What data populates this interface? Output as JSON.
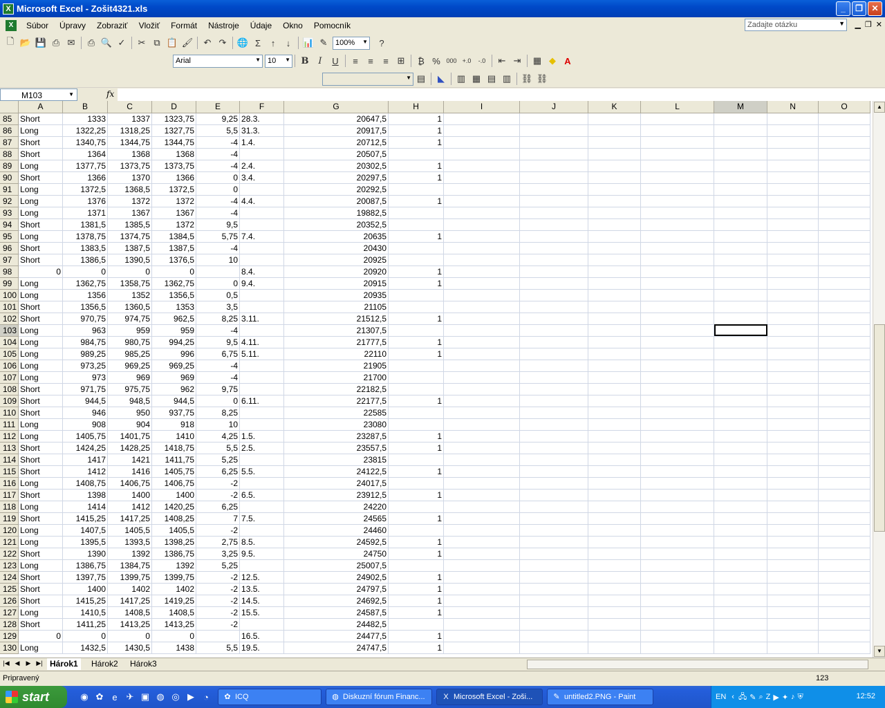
{
  "window": {
    "title": "Microsoft Excel - Zošit4321.xls"
  },
  "menu": [
    "Súbor",
    "Úpravy",
    "Zobraziť",
    "Vložiť",
    "Formát",
    "Nástroje",
    "Údaje",
    "Okno",
    "Pomocník"
  ],
  "help_box": {
    "placeholder": "Zadajte otázku"
  },
  "toolbar": {
    "zoom": "100%",
    "font": "Arial",
    "font_size": "10"
  },
  "formula_bar": {
    "name_box": "M103",
    "fx": "fx",
    "formula": ""
  },
  "columns": [
    "A",
    "B",
    "C",
    "D",
    "E",
    "F",
    "G",
    "H",
    "I",
    "J",
    "K",
    "L",
    "M",
    "N",
    "O"
  ],
  "selected_cell": {
    "row": "103",
    "col": "M"
  },
  "rows": [
    {
      "n": "85",
      "a": "Short",
      "b": "1333",
      "c": "1337",
      "d": "1323,75",
      "e": "9,25",
      "f": "28.3.",
      "g": "20647,5",
      "h": "1"
    },
    {
      "n": "86",
      "a": "Long",
      "b": "1322,25",
      "c": "1318,25",
      "d": "1327,75",
      "e": "5,5",
      "f": "31.3.",
      "g": "20917,5",
      "h": "1"
    },
    {
      "n": "87",
      "a": "Short",
      "b": "1340,75",
      "c": "1344,75",
      "d": "1344,75",
      "e": "-4",
      "f": "1.4.",
      "g": "20712,5",
      "h": "1"
    },
    {
      "n": "88",
      "a": "Short",
      "b": "1364",
      "c": "1368",
      "d": "1368",
      "e": "-4",
      "f": "",
      "g": "20507,5",
      "h": ""
    },
    {
      "n": "89",
      "a": "Long",
      "b": "1377,75",
      "c": "1373,75",
      "d": "1373,75",
      "e": "-4",
      "f": "2.4.",
      "g": "20302,5",
      "h": "1"
    },
    {
      "n": "90",
      "a": "Short",
      "b": "1366",
      "c": "1370",
      "d": "1366",
      "e": "0",
      "f": "3.4.",
      "g": "20297,5",
      "h": "1"
    },
    {
      "n": "91",
      "a": "Long",
      "b": "1372,5",
      "c": "1368,5",
      "d": "1372,5",
      "e": "0",
      "f": "",
      "g": "20292,5",
      "h": ""
    },
    {
      "n": "92",
      "a": "Long",
      "b": "1376",
      "c": "1372",
      "d": "1372",
      "e": "-4",
      "f": "4.4.",
      "g": "20087,5",
      "h": "1"
    },
    {
      "n": "93",
      "a": "Long",
      "b": "1371",
      "c": "1367",
      "d": "1367",
      "e": "-4",
      "f": "",
      "g": "19882,5",
      "h": ""
    },
    {
      "n": "94",
      "a": "Short",
      "b": "1381,5",
      "c": "1385,5",
      "d": "1372",
      "e": "9,5",
      "f": "",
      "g": "20352,5",
      "h": ""
    },
    {
      "n": "95",
      "a": "Long",
      "b": "1378,75",
      "c": "1374,75",
      "d": "1384,5",
      "e": "5,75",
      "f": "7.4.",
      "g": "20635",
      "h": "1"
    },
    {
      "n": "96",
      "a": "Short",
      "b": "1383,5",
      "c": "1387,5",
      "d": "1387,5",
      "e": "-4",
      "f": "",
      "g": "20430",
      "h": ""
    },
    {
      "n": "97",
      "a": "Short",
      "b": "1386,5",
      "c": "1390,5",
      "d": "1376,5",
      "e": "10",
      "f": "",
      "g": "20925",
      "h": ""
    },
    {
      "n": "98",
      "a": "0",
      "b": "0",
      "c": "0",
      "d": "0",
      "e": "",
      "f": "8.4.",
      "g": "20920",
      "h": "1"
    },
    {
      "n": "99",
      "a": "Long",
      "b": "1362,75",
      "c": "1358,75",
      "d": "1362,75",
      "e": "0",
      "f": "9.4.",
      "g": "20915",
      "h": "1"
    },
    {
      "n": "100",
      "a": "Long",
      "b": "1356",
      "c": "1352",
      "d": "1356,5",
      "e": "0,5",
      "f": "",
      "g": "20935",
      "h": ""
    },
    {
      "n": "101",
      "a": "Short",
      "b": "1356,5",
      "c": "1360,5",
      "d": "1353",
      "e": "3,5",
      "f": "",
      "g": "21105",
      "h": ""
    },
    {
      "n": "102",
      "a": "Short",
      "b": "970,75",
      "c": "974,75",
      "d": "962,5",
      "e": "8,25",
      "f": "3.11.",
      "g": "21512,5",
      "h": "1"
    },
    {
      "n": "103",
      "a": "Long",
      "b": "963",
      "c": "959",
      "d": "959",
      "e": "-4",
      "f": "",
      "g": "21307,5",
      "h": ""
    },
    {
      "n": "104",
      "a": "Long",
      "b": "984,75",
      "c": "980,75",
      "d": "994,25",
      "e": "9,5",
      "f": "4.11.",
      "g": "21777,5",
      "h": "1"
    },
    {
      "n": "105",
      "a": "Long",
      "b": "989,25",
      "c": "985,25",
      "d": "996",
      "e": "6,75",
      "f": "5.11.",
      "g": "22110",
      "h": "1"
    },
    {
      "n": "106",
      "a": "Long",
      "b": "973,25",
      "c": "969,25",
      "d": "969,25",
      "e": "-4",
      "f": "",
      "g": "21905",
      "h": ""
    },
    {
      "n": "107",
      "a": "Long",
      "b": "973",
      "c": "969",
      "d": "969",
      "e": "-4",
      "f": "",
      "g": "21700",
      "h": ""
    },
    {
      "n": "108",
      "a": "Short",
      "b": "971,75",
      "c": "975,75",
      "d": "962",
      "e": "9,75",
      "f": "",
      "g": "22182,5",
      "h": ""
    },
    {
      "n": "109",
      "a": "Short",
      "b": "944,5",
      "c": "948,5",
      "d": "944,5",
      "e": "0",
      "f": "6.11.",
      "g": "22177,5",
      "h": "1"
    },
    {
      "n": "110",
      "a": "Short",
      "b": "946",
      "c": "950",
      "d": "937,75",
      "e": "8,25",
      "f": "",
      "g": "22585",
      "h": ""
    },
    {
      "n": "111",
      "a": "Long",
      "b": "908",
      "c": "904",
      "d": "918",
      "e": "10",
      "f": "",
      "g": "23080",
      "h": ""
    },
    {
      "n": "112",
      "a": "Long",
      "b": "1405,75",
      "c": "1401,75",
      "d": "1410",
      "e": "4,25",
      "f": "1.5.",
      "g": "23287,5",
      "h": "1"
    },
    {
      "n": "113",
      "a": "Short",
      "b": "1424,25",
      "c": "1428,25",
      "d": "1418,75",
      "e": "5,5",
      "f": "2.5.",
      "g": "23557,5",
      "h": "1"
    },
    {
      "n": "114",
      "a": "Short",
      "b": "1417",
      "c": "1421",
      "d": "1411,75",
      "e": "5,25",
      "f": "",
      "g": "23815",
      "h": ""
    },
    {
      "n": "115",
      "a": "Short",
      "b": "1412",
      "c": "1416",
      "d": "1405,75",
      "e": "6,25",
      "f": "5.5.",
      "g": "24122,5",
      "h": "1"
    },
    {
      "n": "116",
      "a": "Long",
      "b": "1408,75",
      "c": "1406,75",
      "d": "1406,75",
      "e": "-2",
      "f": "",
      "g": "24017,5",
      "h": ""
    },
    {
      "n": "117",
      "a": "Short",
      "b": "1398",
      "c": "1400",
      "d": "1400",
      "e": "-2",
      "f": "6.5.",
      "g": "23912,5",
      "h": "1"
    },
    {
      "n": "118",
      "a": "Long",
      "b": "1414",
      "c": "1412",
      "d": "1420,25",
      "e": "6,25",
      "f": "",
      "g": "24220",
      "h": ""
    },
    {
      "n": "119",
      "a": "Short",
      "b": "1415,25",
      "c": "1417,25",
      "d": "1408,25",
      "e": "7",
      "f": "7.5.",
      "g": "24565",
      "h": "1"
    },
    {
      "n": "120",
      "a": "Long",
      "b": "1407,5",
      "c": "1405,5",
      "d": "1405,5",
      "e": "-2",
      "f": "",
      "g": "24460",
      "h": ""
    },
    {
      "n": "121",
      "a": "Long",
      "b": "1395,5",
      "c": "1393,5",
      "d": "1398,25",
      "e": "2,75",
      "f": "8.5.",
      "g": "24592,5",
      "h": "1"
    },
    {
      "n": "122",
      "a": "Short",
      "b": "1390",
      "c": "1392",
      "d": "1386,75",
      "e": "3,25",
      "f": "9.5.",
      "g": "24750",
      "h": "1"
    },
    {
      "n": "123",
      "a": "Long",
      "b": "1386,75",
      "c": "1384,75",
      "d": "1392",
      "e": "5,25",
      "f": "",
      "g": "25007,5",
      "h": ""
    },
    {
      "n": "124",
      "a": "Short",
      "b": "1397,75",
      "c": "1399,75",
      "d": "1399,75",
      "e": "-2",
      "f": "12.5.",
      "g": "24902,5",
      "h": "1"
    },
    {
      "n": "125",
      "a": "Short",
      "b": "1400",
      "c": "1402",
      "d": "1402",
      "e": "-2",
      "f": "13.5.",
      "g": "24797,5",
      "h": "1"
    },
    {
      "n": "126",
      "a": "Short",
      "b": "1415,25",
      "c": "1417,25",
      "d": "1419,25",
      "e": "-2",
      "f": "14.5.",
      "g": "24692,5",
      "h": "1"
    },
    {
      "n": "127",
      "a": "Long",
      "b": "1410,5",
      "c": "1408,5",
      "d": "1408,5",
      "e": "-2",
      "f": "15.5.",
      "g": "24587,5",
      "h": "1"
    },
    {
      "n": "128",
      "a": "Short",
      "b": "1411,25",
      "c": "1413,25",
      "d": "1413,25",
      "e": "-2",
      "f": "",
      "g": "24482,5",
      "h": ""
    },
    {
      "n": "129",
      "a": "0",
      "b": "0",
      "c": "0",
      "d": "0",
      "e": "",
      "f": "16.5.",
      "g": "24477,5",
      "h": "1"
    },
    {
      "n": "130",
      "a": "Long",
      "b": "1432,5",
      "c": "1430,5",
      "d": "1438",
      "e": "5,5",
      "f": "19.5.",
      "g": "24747,5",
      "h": "1"
    }
  ],
  "sheet_tabs": [
    "Hárok1",
    "Hárok2",
    "Hárok3"
  ],
  "status": {
    "left": "Pripravený",
    "right": "123"
  },
  "taskbar": {
    "start": "start",
    "tasks": [
      "ICQ",
      "Diskuzní fórum Financ...",
      "Microsoft Excel - Zoši...",
      "untitled2.PNG - Paint"
    ],
    "lang": "EN",
    "clock": "12:52"
  },
  "colors": {
    "title_bar": "#0a5fd8",
    "chrome": "#ece9d8",
    "taskbar": "#245edb",
    "start": "#3c9a3c"
  }
}
